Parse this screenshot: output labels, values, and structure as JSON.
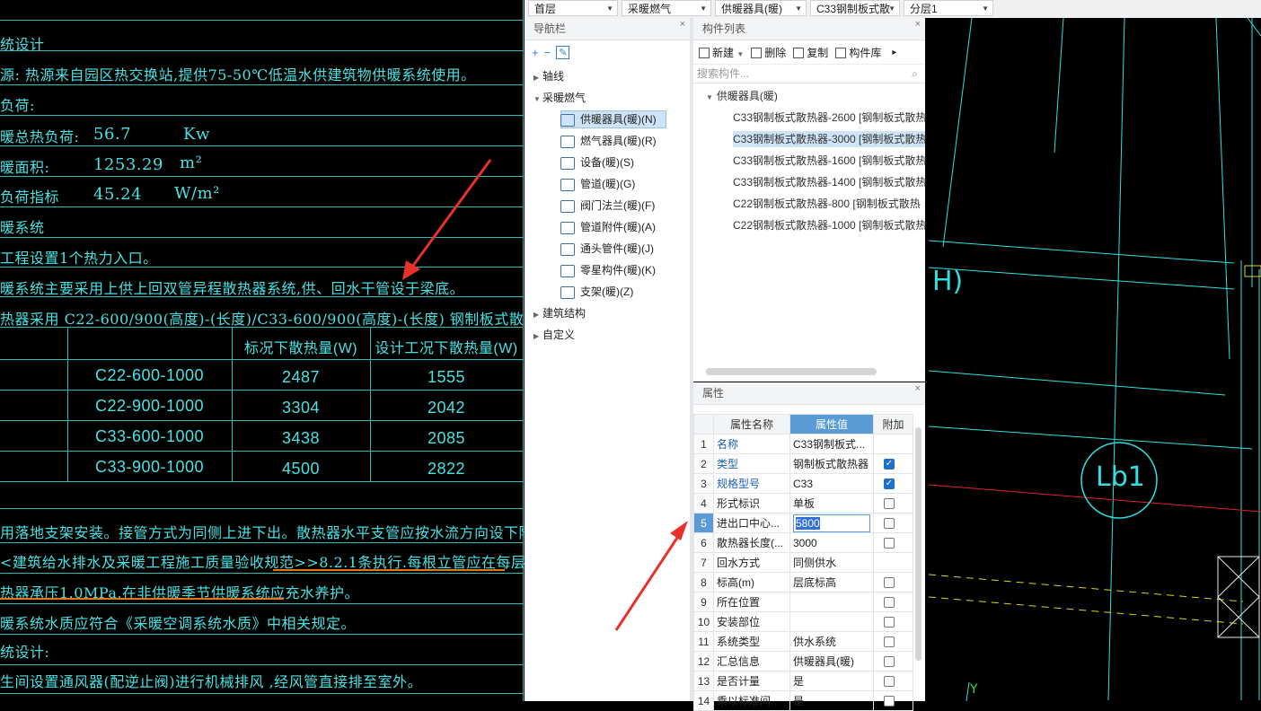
{
  "top_bar": {
    "floor": "首层",
    "discipline": "采暖燃气",
    "category": "供暖器具(暖)",
    "component": "C33钢制板式散",
    "layer": "分层1"
  },
  "cad_left": {
    "lines": [
      "统设计",
      "源:  热源来自园区热交换站,提供75-50℃低温水供建筑物供暖系统使用。",
      "负荷:",
      "暖总热负荷:",
      "暖面积:",
      "负荷指标",
      "暖系统",
      "工程设置1个热力入口。",
      "暖系统主要采用上供上回双管异程散热器系统,供、回水干管设于梁底。",
      "热器采用 C22-600/900(高度)-(长度)/C33-600/900(高度)-(长度) 钢制板式散热器。",
      "用落地支架安装。接管方式为同侧上进下出。散热器水平支管应按水流方向设下降坡,坡度值按",
      "<建筑给水排水及采暖工程施工质量验收规范>>8.2.1条执行.每根立管应在每层距地面1.8M处设立管卡。",
      "热器承压1.0MPa,在非供暖季节供暖系统应充水养护。",
      "暖系统水质应符合《采暖空调系统水质》中相关规定。",
      "统设计:",
      "生间设置通风器(配逆止阀)进行机械排风 ,经风管直接排至室外。"
    ],
    "load_value": "56.7",
    "load_unit": "Kw",
    "area_value": "1253.29",
    "area_unit": "m²",
    "index_value": "45.24",
    "index_unit": "W/m²",
    "table": {
      "headers": [
        "标况下散热量(W)",
        "设计工况下散热量(W)"
      ],
      "rows": [
        [
          "C22-600-1000",
          "2487",
          "1555"
        ],
        [
          "C22-900-1000",
          "3304",
          "2042"
        ],
        [
          "C33-600-1000",
          "3438",
          "2085"
        ],
        [
          "C33-900-1000",
          "4500",
          "2822"
        ]
      ]
    }
  },
  "nav": {
    "title": "导航栏",
    "close": "×",
    "tools": [
      "+",
      "−",
      "✎"
    ],
    "tree": [
      {
        "label": "轴线",
        "type": "group",
        "expanded": false
      },
      {
        "label": "采暖燃气",
        "type": "group",
        "expanded": true
      },
      {
        "label": "供暖器具(暖)(N)",
        "type": "sub",
        "selected": true
      },
      {
        "label": "燃气器具(暖)(R)",
        "type": "sub"
      },
      {
        "label": "设备(暖)(S)",
        "type": "sub"
      },
      {
        "label": "管道(暖)(G)",
        "type": "sub"
      },
      {
        "label": "阀门法兰(暖)(F)",
        "type": "sub"
      },
      {
        "label": "管道附件(暖)(A)",
        "type": "sub"
      },
      {
        "label": "通头管件(暖)(J)",
        "type": "sub"
      },
      {
        "label": "零星构件(暖)(K)",
        "type": "sub"
      },
      {
        "label": "支架(暖)(Z)",
        "type": "sub"
      },
      {
        "label": "建筑结构",
        "type": "group",
        "expanded": false
      },
      {
        "label": "自定义",
        "type": "group",
        "expanded": false
      }
    ]
  },
  "components": {
    "title": "构件列表",
    "close": "×",
    "toolbar": {
      "new": "新建",
      "delete": "删除",
      "copy": "复制",
      "library": "构件库"
    },
    "search_placeholder": "搜索构件...",
    "group": "供暖器具(暖)",
    "items": [
      "C33钢制板式散热器-2600 [钢制板式散热",
      "C33钢制板式散热器-3000 [钢制板式散热",
      "C33钢制板式散热器-1600 [钢制板式散热",
      "C33钢制板式散热器-1400 [钢制板式散热",
      "C22钢制板式散热器-800 [钢制板式散热",
      "C22钢制板式散热器-1000 [钢制板式散热"
    ],
    "selected_index": 1
  },
  "properties": {
    "title": "属性",
    "close": "×",
    "headers": [
      "属性名称",
      "属性值",
      "附加"
    ],
    "rows": [
      {
        "no": "1",
        "name": "名称",
        "value": "C33钢制板式...",
        "checkbox": null,
        "blue": true
      },
      {
        "no": "2",
        "name": "类型",
        "value": "钢制板式散热器",
        "checkbox": true,
        "blue": true
      },
      {
        "no": "3",
        "name": "规格型号",
        "value": "C33",
        "checkbox": true,
        "blue": true
      },
      {
        "no": "4",
        "name": "形式标识",
        "value": "单板",
        "checkbox": false
      },
      {
        "no": "5",
        "name": "进出口中心...",
        "value": "5800",
        "checkbox": false,
        "active": true
      },
      {
        "no": "6",
        "name": "散热器长度(...",
        "value": "3000",
        "checkbox": false
      },
      {
        "no": "7",
        "name": "回水方式",
        "value": "同侧供水",
        "checkbox": null
      },
      {
        "no": "8",
        "name": "标高(m)",
        "value": "层底标高",
        "checkbox": false
      },
      {
        "no": "9",
        "name": "所在位置",
        "value": "",
        "checkbox": false
      },
      {
        "no": "10",
        "name": "安装部位",
        "value": "",
        "checkbox": false
      },
      {
        "no": "11",
        "name": "系统类型",
        "value": "供水系统",
        "checkbox": false
      },
      {
        "no": "12",
        "name": "汇总信息",
        "value": "供暖器具(暖)",
        "checkbox": false
      },
      {
        "no": "13",
        "name": "是否计量",
        "value": "是",
        "checkbox": false
      },
      {
        "no": "14",
        "name": "乘以标准间...",
        "value": "是",
        "checkbox": false
      }
    ]
  },
  "cad_right": {
    "label_lb1": "Lb1",
    "label_h": "H)",
    "label_y": "Y"
  },
  "colors": {
    "cad_cyan": "#48e2e2",
    "cad_red": "#e0212b",
    "arrow_red": "#e8312a",
    "accent_blue": "#5b9bd5"
  }
}
